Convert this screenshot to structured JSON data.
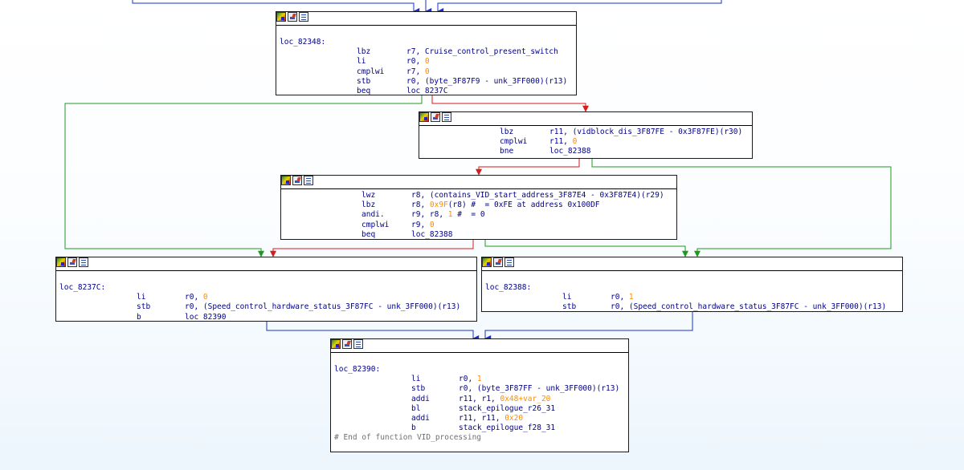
{
  "colors": {
    "code_text": "#000088",
    "immediate": "#ff8a00",
    "comment": "#707070",
    "edge_unconditional": "#1530d0",
    "edge_true": "#1f9a1f",
    "edge_false": "#d81b1b",
    "node_border": "#1a1a1a",
    "background": "#f4f9fe"
  },
  "node_icons": [
    "node-color-icon",
    "node-edit-icon",
    "node-graph-icon"
  ],
  "nodes": {
    "b1": {
      "label": "loc_82348:",
      "ins": [
        {
          "m": "lbz",
          "a": "r7, Cruise_control_present_switch"
        },
        {
          "m": "li",
          "a": "r0, ",
          "n": "0"
        },
        {
          "m": "cmplwi",
          "a": "r7, ",
          "n": "0"
        },
        {
          "m": "stb",
          "a": "r0, (byte_3F87F9 - unk_3FF000)(r13)"
        },
        {
          "m": "beq",
          "a": "loc_8237C"
        }
      ]
    },
    "b2": {
      "ins": [
        {
          "m": "lbz",
          "a": "r11, (vidblock_dis_3F87FE - 0x3F87FE)(r30)"
        },
        {
          "m": "cmplwi",
          "a": "r11, ",
          "n": "0"
        },
        {
          "m": "bne",
          "a": "loc_82388"
        }
      ]
    },
    "b3": {
      "ins": [
        {
          "m": "lwz",
          "a": "r8, (contains_VID_start_address_3F87E4 - 0x3F87E4)(r29)"
        },
        {
          "m": "lbz",
          "a": "r8, ",
          "n": "0x9F",
          "tail": "(r8) #  = 0xFE at address 0x100DF"
        },
        {
          "m": "andi.",
          "a": "r9, r8, ",
          "n": "1",
          "tail": " #  = 0"
        },
        {
          "m": "cmplwi",
          "a": "r9, ",
          "n": "0"
        },
        {
          "m": "beq",
          "a": "loc_82388"
        }
      ]
    },
    "b4": {
      "label": "loc_8237C:",
      "ins": [
        {
          "m": "li",
          "a": "r0, ",
          "n": "0"
        },
        {
          "m": "stb",
          "a": "r0, (Speed_control_hardware_status_3F87FC - unk_3FF000)(r13)"
        },
        {
          "m": "b",
          "a": "loc_82390"
        }
      ]
    },
    "b5": {
      "label": "loc_82388:",
      "ins": [
        {
          "m": "li",
          "a": "r0, ",
          "n": "1"
        },
        {
          "m": "stb",
          "a": "r0, (Speed_control_hardware_status_3F87FC - unk_3FF000)(r13)"
        }
      ]
    },
    "b6": {
      "label": "loc_82390:",
      "ins": [
        {
          "m": "li",
          "a": "r0, ",
          "n": "1"
        },
        {
          "m": "stb",
          "a": "r0, (byte_3F87FF - unk_3FF000)(r13)"
        },
        {
          "m": "addi",
          "a": "r11, r1, ",
          "n": "0x48+var_20"
        },
        {
          "m": "bl",
          "a": "stack_epilogue_r26_31"
        },
        {
          "m": "addi",
          "a": "r11, r11, ",
          "n": "0x20"
        },
        {
          "m": "b",
          "a": "stack_epilogue_f28_31"
        }
      ],
      "comment": "# End of function VID_processing"
    }
  }
}
